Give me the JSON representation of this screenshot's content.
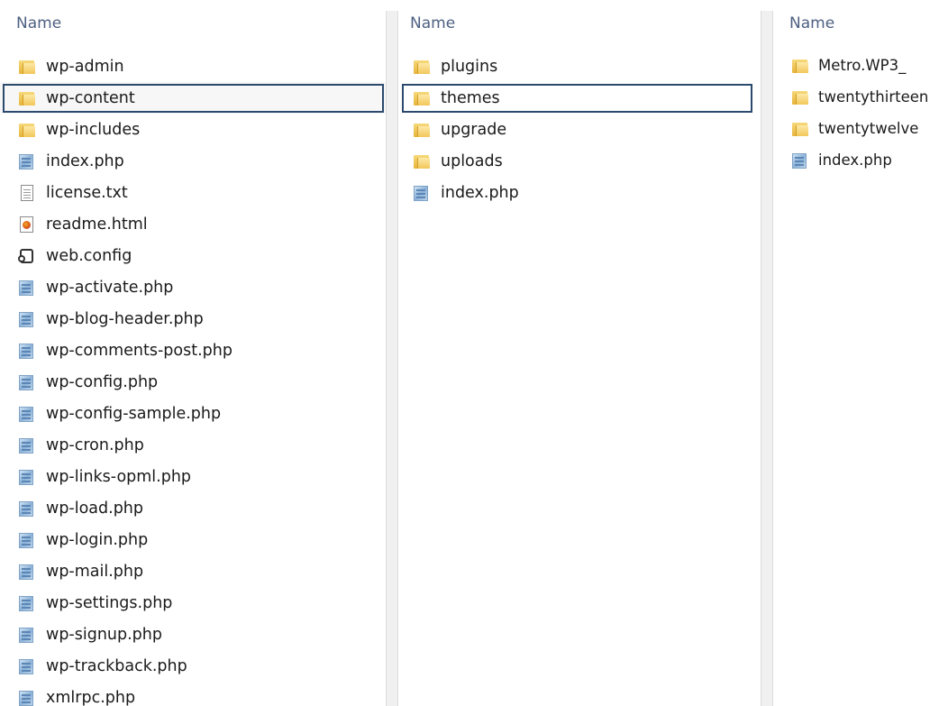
{
  "panes": [
    {
      "header": "Name",
      "items": [
        {
          "name": "wp-admin",
          "type": "folder"
        },
        {
          "name": "wp-content",
          "type": "folder",
          "selected": true
        },
        {
          "name": "wp-includes",
          "type": "folder"
        },
        {
          "name": "index.php",
          "type": "php"
        },
        {
          "name": "license.txt",
          "type": "txt"
        },
        {
          "name": "readme.html",
          "type": "html"
        },
        {
          "name": "web.config",
          "type": "cfg"
        },
        {
          "name": "wp-activate.php",
          "type": "php"
        },
        {
          "name": "wp-blog-header.php",
          "type": "php"
        },
        {
          "name": "wp-comments-post.php",
          "type": "php"
        },
        {
          "name": "wp-config.php",
          "type": "php"
        },
        {
          "name": "wp-config-sample.php",
          "type": "php"
        },
        {
          "name": "wp-cron.php",
          "type": "php"
        },
        {
          "name": "wp-links-opml.php",
          "type": "php"
        },
        {
          "name": "wp-load.php",
          "type": "php"
        },
        {
          "name": "wp-login.php",
          "type": "php"
        },
        {
          "name": "wp-mail.php",
          "type": "php"
        },
        {
          "name": "wp-settings.php",
          "type": "php"
        },
        {
          "name": "wp-signup.php",
          "type": "php"
        },
        {
          "name": "wp-trackback.php",
          "type": "php"
        },
        {
          "name": "xmlrpc.php",
          "type": "php"
        }
      ]
    },
    {
      "header": "Name",
      "items": [
        {
          "name": "plugins",
          "type": "folder"
        },
        {
          "name": "themes",
          "type": "folder",
          "selected": true
        },
        {
          "name": "upgrade",
          "type": "folder"
        },
        {
          "name": "uploads",
          "type": "folder"
        },
        {
          "name": "index.php",
          "type": "php"
        }
      ]
    },
    {
      "header": "Name",
      "items": [
        {
          "name": "Metro.WP3_",
          "type": "folder"
        },
        {
          "name": "twentythirteen",
          "type": "folder"
        },
        {
          "name": "twentytwelve",
          "type": "folder"
        },
        {
          "name": "index.php",
          "type": "php"
        }
      ]
    }
  ],
  "icons": {
    "folder": "folder-icon",
    "php": "php-file-icon",
    "txt": "text-file-icon",
    "html": "html-file-icon",
    "cfg": "config-file-icon"
  },
  "colors": {
    "header_text": "#4d6082",
    "selection_border": "#2c4a6e",
    "folder": "#f2c75a"
  }
}
